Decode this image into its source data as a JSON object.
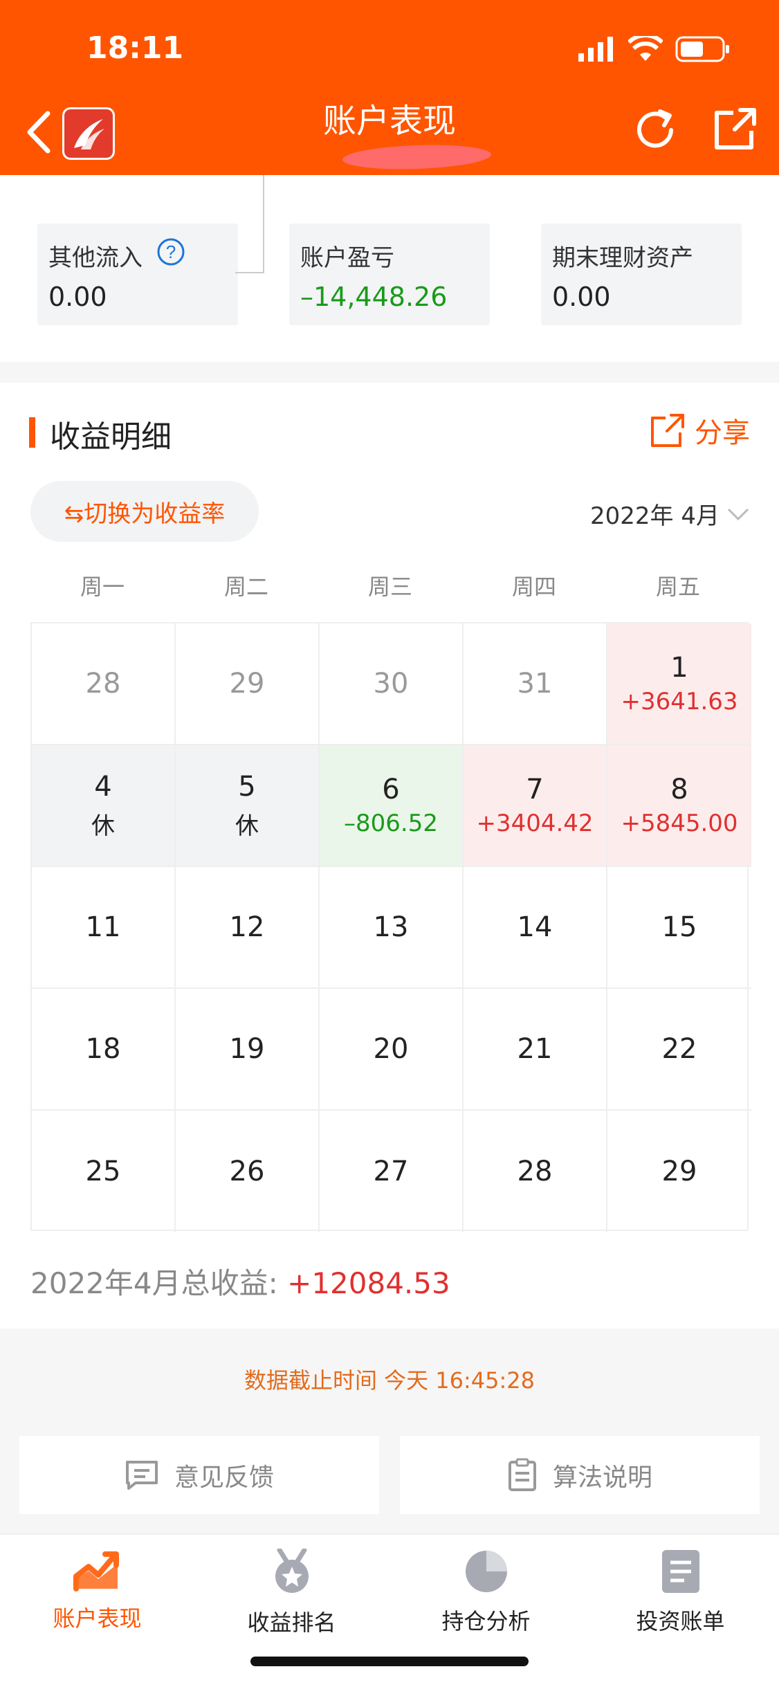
{
  "status_bar": {
    "time": "18:11"
  },
  "header": {
    "title": "账户表现"
  },
  "summary": [
    {
      "label": "其他流入",
      "value": "0.00",
      "value_color": "#222222"
    },
    {
      "label": "账户盈亏",
      "value": "–14,448.26",
      "value_color": "#1a9a1a"
    },
    {
      "label": "期末理财资产",
      "value": "0.00",
      "value_color": "#222222"
    }
  ],
  "section": {
    "title": "收益明细",
    "share_label": "分享",
    "switch_label": "⇆切换为收益率",
    "month_label": "2022年 4月"
  },
  "weekdays": [
    "周一",
    "周二",
    "周三",
    "周四",
    "周五"
  ],
  "calendar": [
    [
      {
        "day": "28",
        "value": "",
        "state": "prev"
      },
      {
        "day": "29",
        "value": "",
        "state": "prev"
      },
      {
        "day": "30",
        "value": "",
        "state": "prev"
      },
      {
        "day": "31",
        "value": "",
        "state": "prev"
      },
      {
        "day": "1",
        "value": "+3641.63",
        "state": "gain"
      }
    ],
    [
      {
        "day": "4",
        "value": "休",
        "state": "rest"
      },
      {
        "day": "5",
        "value": "休",
        "state": "rest"
      },
      {
        "day": "6",
        "value": "–806.52",
        "state": "loss"
      },
      {
        "day": "7",
        "value": "+3404.42",
        "state": "gain"
      },
      {
        "day": "8",
        "value": "+5845.00",
        "state": "gain"
      }
    ],
    [
      {
        "day": "11",
        "value": "",
        "state": "future"
      },
      {
        "day": "12",
        "value": "",
        "state": "future"
      },
      {
        "day": "13",
        "value": "",
        "state": "future"
      },
      {
        "day": "14",
        "value": "",
        "state": "future"
      },
      {
        "day": "15",
        "value": "",
        "state": "future"
      }
    ],
    [
      {
        "day": "18",
        "value": "",
        "state": "future"
      },
      {
        "day": "19",
        "value": "",
        "state": "future"
      },
      {
        "day": "20",
        "value": "",
        "state": "future"
      },
      {
        "day": "21",
        "value": "",
        "state": "future"
      },
      {
        "day": "22",
        "value": "",
        "state": "future"
      }
    ],
    [
      {
        "day": "25",
        "value": "",
        "state": "future"
      },
      {
        "day": "26",
        "value": "",
        "state": "future"
      },
      {
        "day": "27",
        "value": "",
        "state": "future"
      },
      {
        "day": "28",
        "value": "",
        "state": "future"
      },
      {
        "day": "29",
        "value": "",
        "state": "future"
      }
    ]
  ],
  "total": {
    "label": "2022年4月总收益: ",
    "value": "+12084.53"
  },
  "cutoff": "数据截止时间 今天 16:45:28",
  "buttons": {
    "feedback": "意见反馈",
    "algorithm": "算法说明"
  },
  "tabs": [
    {
      "label": "账户表现",
      "icon": "trend-chart-icon",
      "active": true
    },
    {
      "label": "收益排名",
      "icon": "medal-icon",
      "active": false
    },
    {
      "label": "持仓分析",
      "icon": "pie-chart-icon",
      "active": false
    },
    {
      "label": "投资账单",
      "icon": "bill-icon",
      "active": false
    }
  ],
  "colors": {
    "brand": "#ff5500",
    "gain": "#e03030",
    "loss": "#1a9a1a",
    "gain_bg": "#fdecec",
    "loss_bg": "#eaf6ea",
    "rest_bg": "#f2f3f5"
  }
}
